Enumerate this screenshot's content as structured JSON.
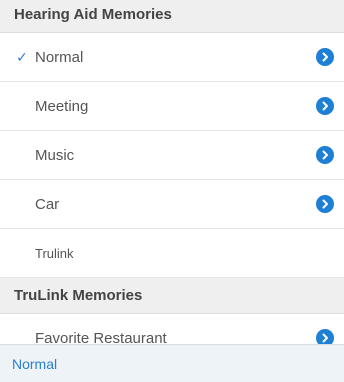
{
  "hearing_aid_section": {
    "title": "Hearing Aid Memories",
    "items": [
      {
        "label": "Normal",
        "checked": true,
        "has_detail": true
      },
      {
        "label": "Meeting",
        "checked": false,
        "has_detail": true
      },
      {
        "label": "Music",
        "checked": false,
        "has_detail": true
      },
      {
        "label": "Car",
        "checked": false,
        "has_detail": true
      },
      {
        "label": "Trulink",
        "checked": false,
        "has_detail": false
      }
    ]
  },
  "trulink_section": {
    "title": "TruLink Memories",
    "items": [
      {
        "label": "Favorite Restaurant",
        "checked": false,
        "has_detail": true
      }
    ]
  },
  "status_bar": {
    "current_memory": "Normal"
  },
  "icons": {
    "check": "checkmark-icon",
    "detail": "chevron-right-circle-icon"
  },
  "colors": {
    "accent": "#1e7fd4",
    "header_bg": "#efefef",
    "status_bg": "#eef3f8"
  }
}
